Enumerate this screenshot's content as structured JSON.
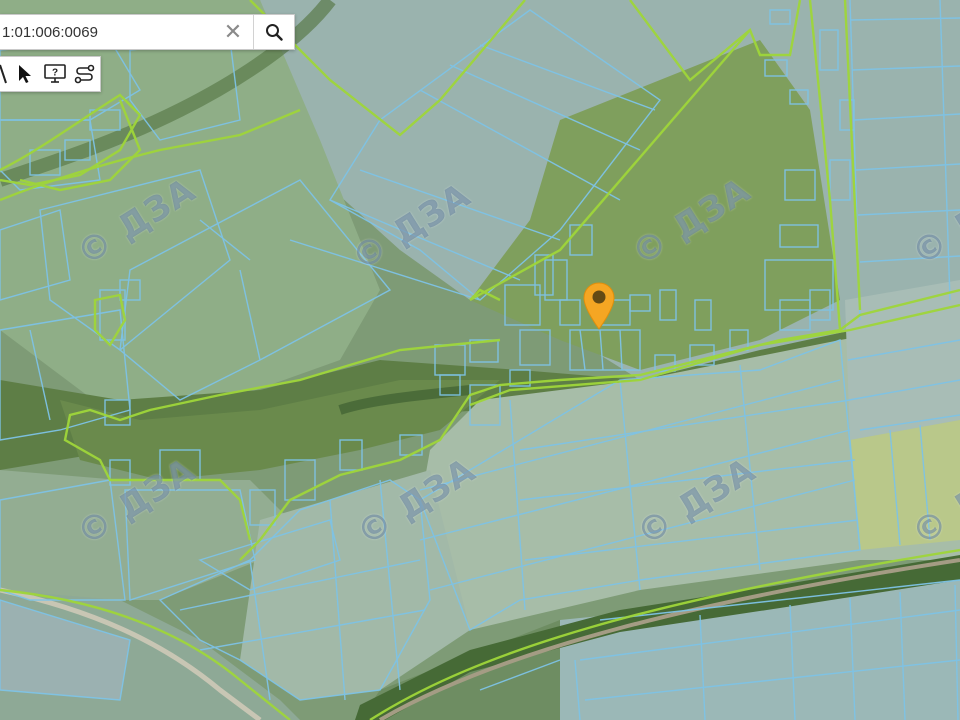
{
  "search": {
    "value": "1:01:006:0069",
    "clear_symbol": "✕"
  },
  "toolbar": {
    "tools": [
      {
        "name": "ruler-icon"
      },
      {
        "name": "select-pointer-icon"
      },
      {
        "name": "identify-info-icon"
      },
      {
        "name": "route-measure-icon"
      }
    ]
  },
  "map": {
    "watermark_text": "© ДЗА",
    "parcel_outline_color": "#7ec3e6",
    "boundary_line_color": "#9fd63a",
    "marker_color": "#f5a623",
    "marker_icon": "location-pin-icon"
  }
}
